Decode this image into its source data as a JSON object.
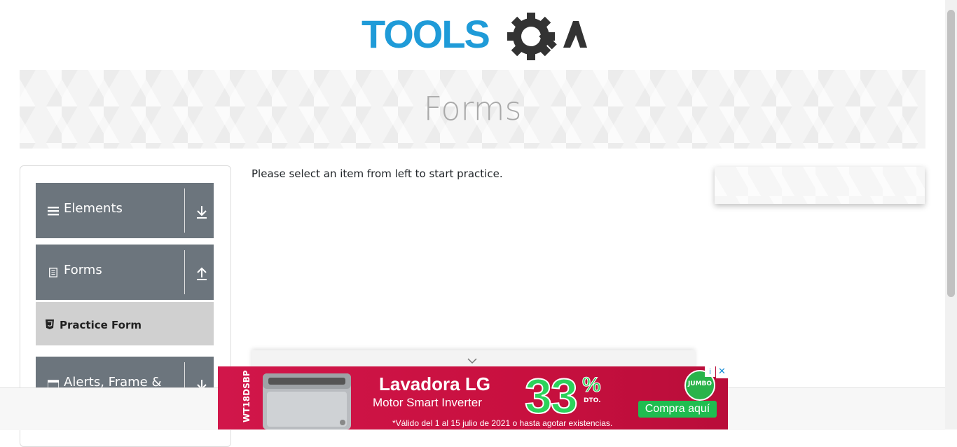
{
  "logo": {
    "text_tools": "TOOLS",
    "text_qa": "QA",
    "brand_color": "#1f9bd8",
    "gear_color": "#333333"
  },
  "banner": {
    "title": "Forms"
  },
  "sidebar": {
    "groups": [
      {
        "label": "Elements",
        "icon": "hamburger-icon",
        "toggle": "download-arrow-icon"
      },
      {
        "label": "Forms",
        "icon": "document-icon",
        "toggle": "upload-arrow-icon"
      },
      {
        "label": "Alerts, Frame &",
        "icon": "window-icon",
        "toggle": "download-arrow-icon"
      }
    ],
    "forms_items": [
      {
        "label": "Practice Form",
        "icon": "html5-icon"
      }
    ]
  },
  "main": {
    "intro": "Please select an item from left to start practice."
  },
  "ad": {
    "model": "WT18DSBP",
    "headline": "Lavadora LG",
    "subheadline": "Motor Smart Inverter",
    "discount": "33",
    "percent": "%",
    "discount_label": "DTO.",
    "brand": "JUMBO",
    "cta": "Compra aquí",
    "legal": "*Válido del 1 al 15 julio de 2021 o hasta agotar existencias.",
    "info_glyph": "i",
    "close_glyph": "✕"
  }
}
